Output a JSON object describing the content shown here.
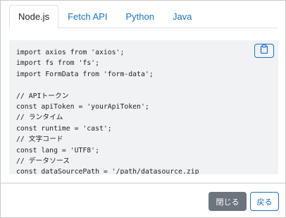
{
  "tabs": [
    {
      "label": "Node.js",
      "active": true
    },
    {
      "label": "Fetch API",
      "active": false
    },
    {
      "label": "Python",
      "active": false
    },
    {
      "label": "Java",
      "active": false
    }
  ],
  "code_lines": [
    "import axios from 'axios';",
    "import fs from 'fs';",
    "import FormData from 'form-data';",
    "",
    "// APIトークン",
    "const apiToken = 'yourApiToken';",
    "// ランタイム",
    "const runtime = 'cast';",
    "// 文字コード",
    "const lang = 'UTF8';",
    "// データソース",
    "const dataSourcePath = '/path/datasource.zip"
  ],
  "copy_icon": "clipboard-icon",
  "footer": {
    "close_label": "閉じる",
    "back_label": "戻る"
  },
  "colors": {
    "accent": "#1a73c6",
    "secondary_button": "#6c757d",
    "code_background": "#f1f2f4"
  }
}
